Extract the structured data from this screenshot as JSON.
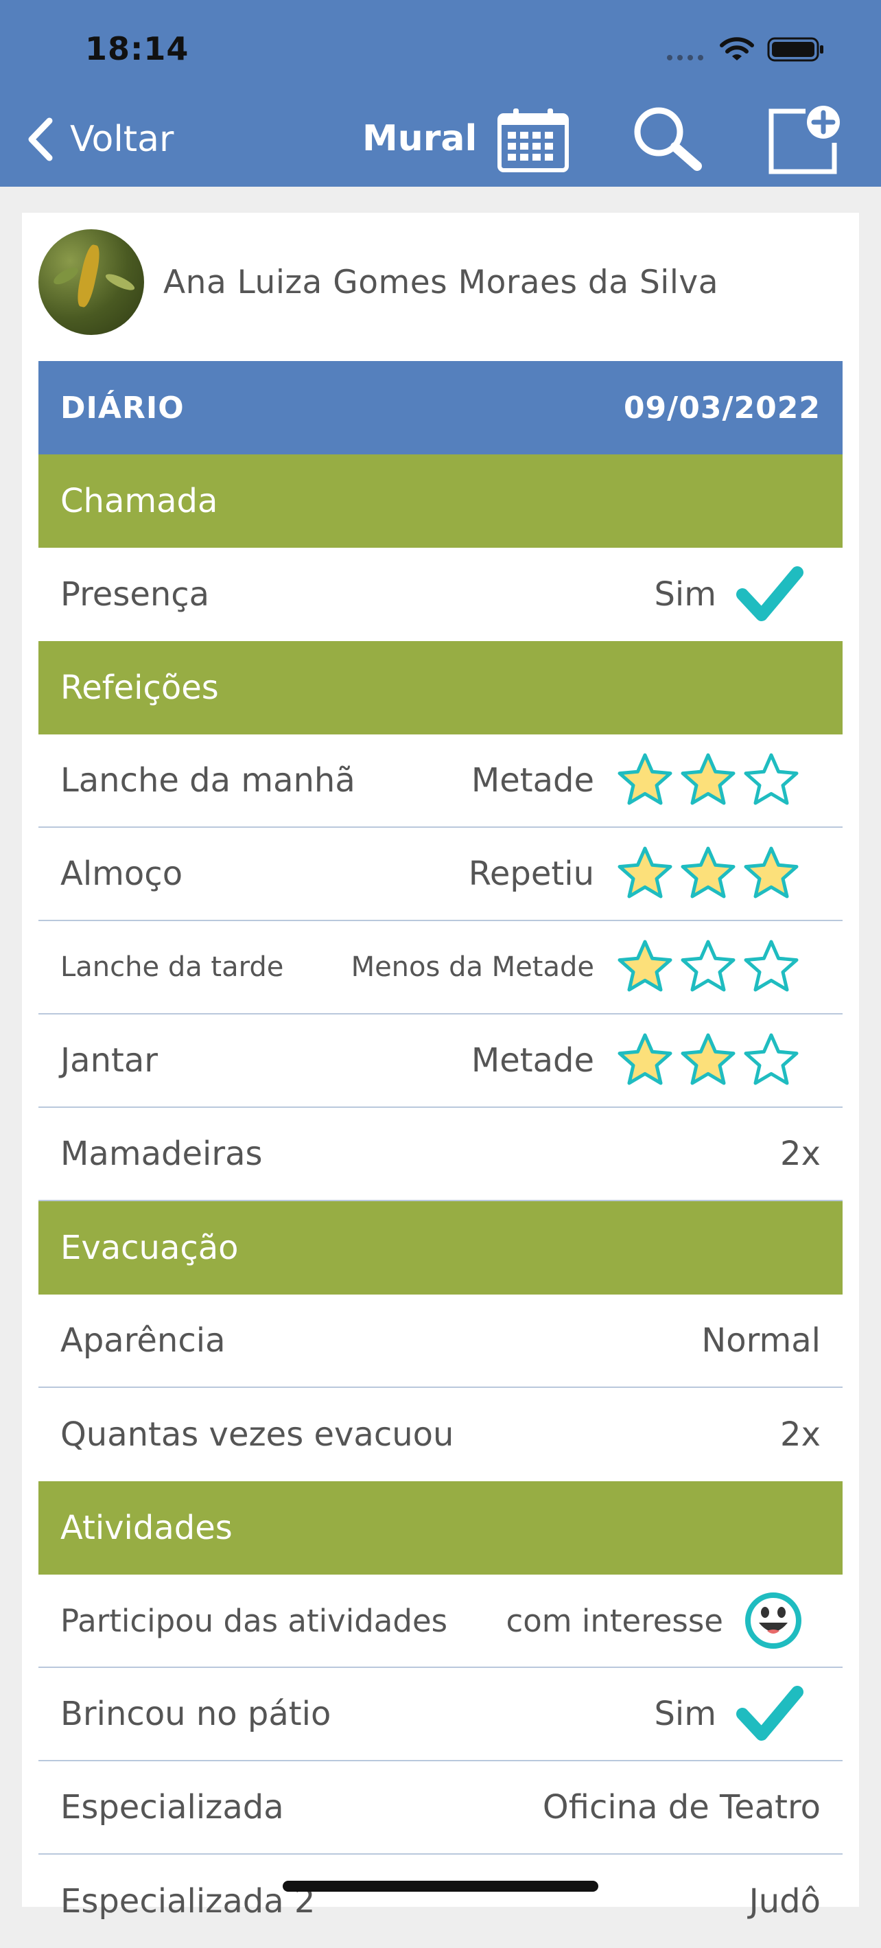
{
  "status_bar": {
    "time": "18:14"
  },
  "nav": {
    "back_label": "Voltar",
    "title": "Mural",
    "icons": [
      "calendar-icon",
      "search-icon",
      "new-post-icon"
    ]
  },
  "post": {
    "author_name": "Ana Luiza Gomes Moraes da Silva",
    "diary_label": "DIÁRIO",
    "date": "09/03/2022",
    "sections": {
      "chamada": {
        "title": "Chamada",
        "presenca": {
          "label": "Presença",
          "value": "Sim"
        }
      },
      "refeicoes": {
        "title": "Refeições",
        "rows": [
          {
            "label": "Lanche da manhã",
            "value": "Metade",
            "stars": 2
          },
          {
            "label": "Almoço",
            "value": "Repetiu",
            "stars": 3
          },
          {
            "label": "Lanche da tarde",
            "value": "Menos da Metade",
            "stars": 1
          },
          {
            "label": "Jantar",
            "value": "Metade",
            "stars": 2
          }
        ],
        "mamadeiras": {
          "label": "Mamadeiras",
          "value": "2x"
        }
      },
      "evacuacao": {
        "title": "Evacuação",
        "aparencia": {
          "label": "Aparência",
          "value": "Normal"
        },
        "quantas": {
          "label": "Quantas vezes evacuou",
          "value": "2x"
        }
      },
      "atividades": {
        "title": "Atividades",
        "participou": {
          "label": "Participou das atividades",
          "value": "com interesse"
        },
        "brincou": {
          "label": "Brincou no pátio",
          "value": "Sim"
        },
        "especializada": {
          "label": "Especializada",
          "value": "Oficina de Teatro"
        },
        "especializada2": {
          "label": "Especializada 2",
          "value": "Judô"
        }
      }
    }
  },
  "colors": {
    "nav_blue": "#5580bd",
    "section_green": "#97ad44",
    "accent_teal": "#1fbcc0",
    "star_fill": "#fce07a"
  }
}
